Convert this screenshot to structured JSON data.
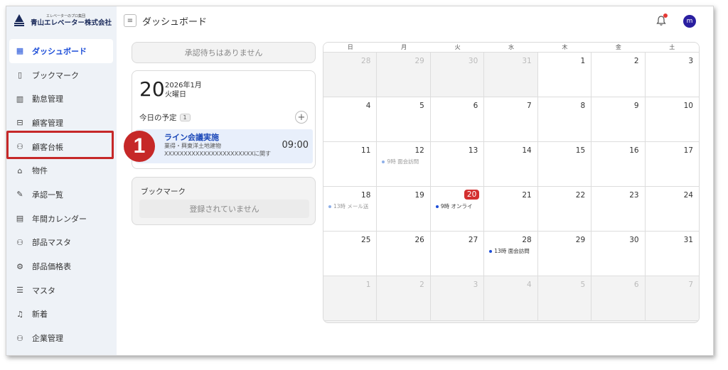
{
  "brand": {
    "tagline": "エレベーターのプロ集団",
    "company": "青山エレベーター株式会社"
  },
  "sidebar": {
    "items": [
      {
        "label": "ダッシュボード",
        "icon": "dashboard-icon",
        "active": true
      },
      {
        "label": "ブックマーク",
        "icon": "bookmark-icon"
      },
      {
        "label": "勤怠管理",
        "icon": "attendance-icon"
      },
      {
        "label": "顧客管理",
        "icon": "briefcase-icon"
      },
      {
        "label": "顧客台帳",
        "icon": "users-icon"
      },
      {
        "label": "物件",
        "icon": "building-icon"
      },
      {
        "label": "承認一覧",
        "icon": "approval-icon"
      },
      {
        "label": "年間カレンダー",
        "icon": "calendar-icon"
      },
      {
        "label": "部品マスタ",
        "icon": "users-icon"
      },
      {
        "label": "部品価格表",
        "icon": "gear-icon"
      },
      {
        "label": "マスタ",
        "icon": "list-icon"
      },
      {
        "label": "新着",
        "icon": "bell-plus-icon"
      },
      {
        "label": "企業管理",
        "icon": "users-icon"
      }
    ]
  },
  "header": {
    "title": "ダッシュボード",
    "avatar_initial": "m"
  },
  "pending": {
    "text": "承認待ちはありません"
  },
  "today": {
    "day": "20",
    "year_month": "2026年1月",
    "weekday": "火曜日",
    "schedule_label": "今日の予定",
    "schedule_count": "1",
    "event": {
      "title": "ライン会議実施",
      "sub1": "業得・興東洋土地建物",
      "sub2": "XXXXXXXXXXXXXXXXXXXXXXXに関するオ...",
      "time": "09:00"
    }
  },
  "step_marker": "1",
  "bookmark": {
    "title": "ブックマーク",
    "empty_text": "登録されていません"
  },
  "calendar": {
    "weekdays": [
      "日",
      "月",
      "火",
      "水",
      "木",
      "金",
      "土"
    ],
    "weeks": [
      [
        {
          "d": "28",
          "o": true
        },
        {
          "d": "29",
          "o": true
        },
        {
          "d": "30",
          "o": true
        },
        {
          "d": "31",
          "o": true
        },
        {
          "d": "1"
        },
        {
          "d": "2"
        },
        {
          "d": "3"
        }
      ],
      [
        {
          "d": "4"
        },
        {
          "d": "5"
        },
        {
          "d": "6"
        },
        {
          "d": "7"
        },
        {
          "d": "8"
        },
        {
          "d": "9"
        },
        {
          "d": "10"
        }
      ],
      [
        {
          "d": "11"
        },
        {
          "d": "12",
          "ev": "9時 面会訪問"
        },
        {
          "d": "13"
        },
        {
          "d": "14"
        },
        {
          "d": "15"
        },
        {
          "d": "16"
        },
        {
          "d": "17"
        }
      ],
      [
        {
          "d": "18",
          "ev": "13時 メール送"
        },
        {
          "d": "19"
        },
        {
          "d": "20",
          "today": true,
          "ev": "9時 オンライ",
          "evdark": true
        },
        {
          "d": "21"
        },
        {
          "d": "22"
        },
        {
          "d": "23"
        },
        {
          "d": "24"
        }
      ],
      [
        {
          "d": "25"
        },
        {
          "d": "26"
        },
        {
          "d": "27"
        },
        {
          "d": "28",
          "ev": "13時 面会訪問",
          "evdark": true
        },
        {
          "d": "29"
        },
        {
          "d": "30"
        },
        {
          "d": "31"
        }
      ],
      [
        {
          "d": "1",
          "o": true
        },
        {
          "d": "2",
          "o": true
        },
        {
          "d": "3",
          "o": true
        },
        {
          "d": "4",
          "o": true
        },
        {
          "d": "5",
          "o": true
        },
        {
          "d": "6",
          "o": true
        },
        {
          "d": "7",
          "o": true
        }
      ]
    ]
  },
  "colors": {
    "accent": "#1d4ed8",
    "highlight": "#c62828",
    "today": "#d32f2f",
    "sidebar_bg": "#eef2f7"
  }
}
